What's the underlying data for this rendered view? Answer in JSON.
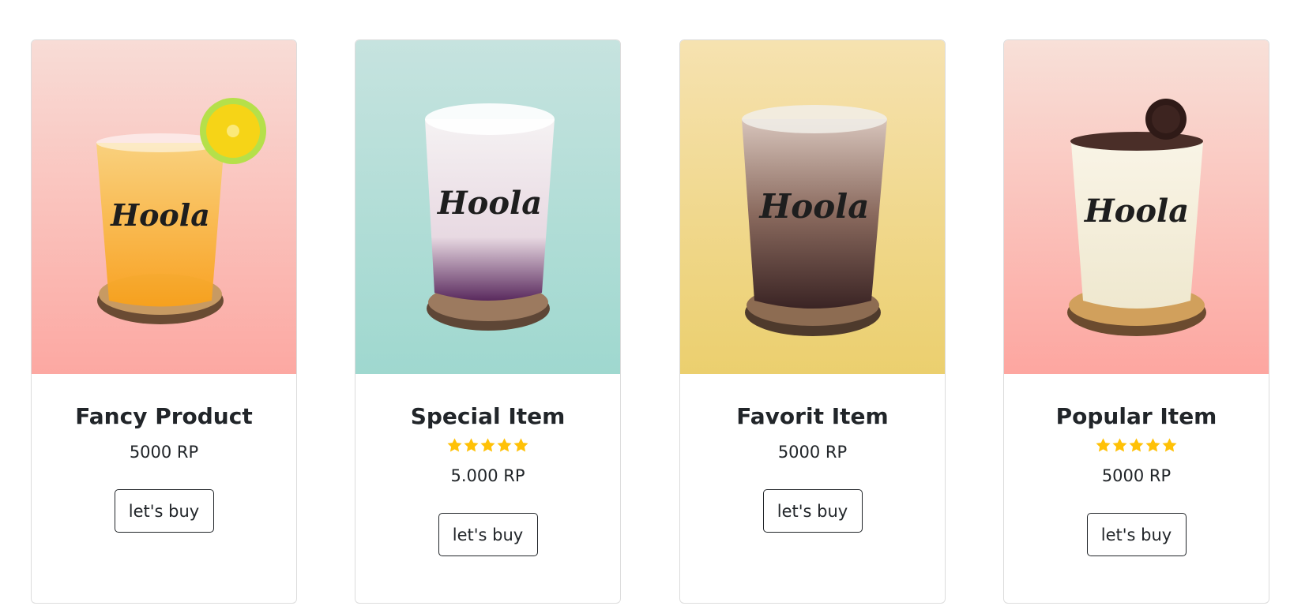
{
  "products": [
    {
      "name": "Fancy Product",
      "price": "5000 RP",
      "rating": null,
      "button_label": "let's buy",
      "bg_top": "#f8dcd6",
      "bg_bottom": "#fca8a2",
      "drink_color": "#f9a11b",
      "cup_logo": "Hoola"
    },
    {
      "name": "Special Item",
      "price": "5.000 RP",
      "rating": 5,
      "button_label": "let's buy",
      "bg_top": "#c6e3df",
      "bg_bottom": "#9fd8cf",
      "drink_color": "#f1ecef",
      "cup_logo": "Hoola"
    },
    {
      "name": "Favorit Item",
      "price": "5000 RP",
      "rating": null,
      "button_label": "let's buy",
      "bg_top": "#f6e2b0",
      "bg_bottom": "#ebcf6e",
      "drink_color": "#8a6a5e",
      "cup_logo": "Hoola"
    },
    {
      "name": "Popular Item",
      "price": "5000 RP",
      "rating": 5,
      "button_label": "let's buy",
      "bg_top": "#f8e0d8",
      "bg_bottom": "#fda6a0",
      "drink_color": "#f4f0df",
      "cup_logo": "Hoola"
    }
  ],
  "star_color": "#ffc107"
}
